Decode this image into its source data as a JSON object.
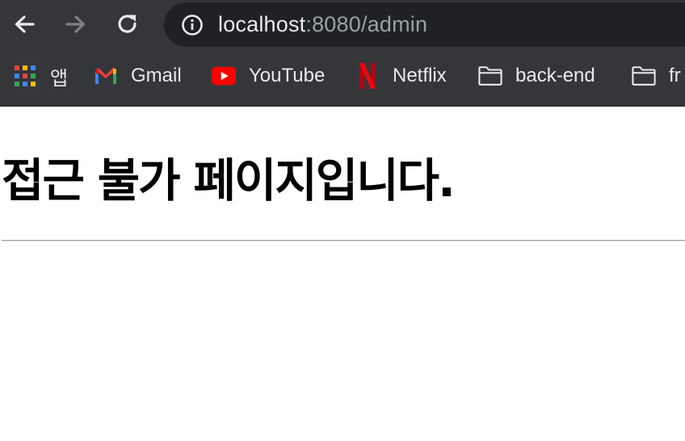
{
  "toolbar": {
    "back_icon": "arrow-left-icon",
    "forward_icon": "arrow-right-icon",
    "reload_icon": "reload-icon",
    "info_icon": "info-icon",
    "url_host": "localhost",
    "url_rest": ":8080/admin"
  },
  "bookmarks": [
    {
      "label": "앱",
      "icon": "apps-grid-icon"
    },
    {
      "label": "Gmail",
      "icon": "gmail-icon"
    },
    {
      "label": "YouTube",
      "icon": "youtube-icon"
    },
    {
      "label": "Netflix",
      "icon": "netflix-icon"
    },
    {
      "label": "back-end",
      "icon": "folder-icon"
    },
    {
      "label": "fr",
      "icon": "folder-icon"
    }
  ],
  "page": {
    "heading": "접근 불가 페이지입니다."
  },
  "colors": {
    "toolbar_bg": "#35363a",
    "omnibox_bg": "#202124",
    "youtube_red": "#ff0000",
    "netflix_red": "#e50914"
  }
}
